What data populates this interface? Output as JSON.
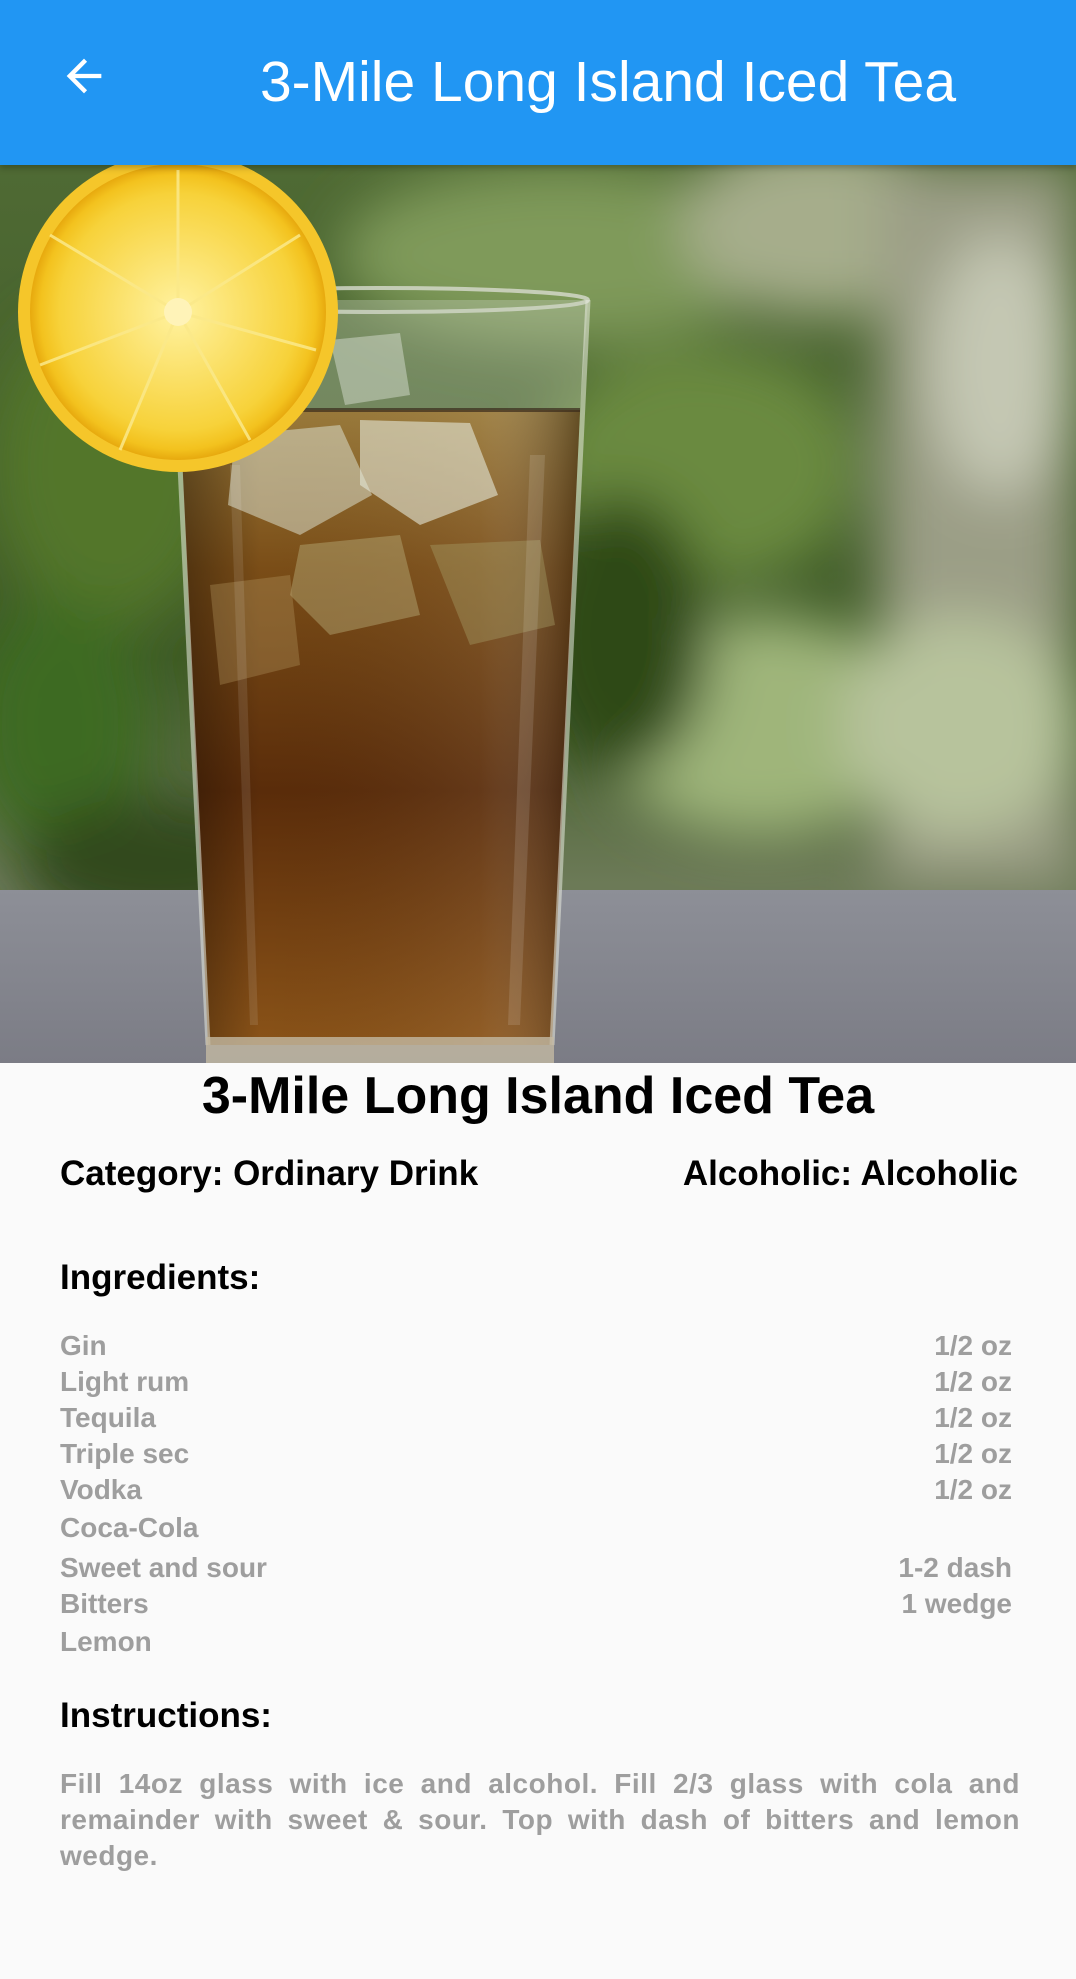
{
  "appbar": {
    "title": "3-Mile Long Island Iced Tea",
    "back_icon": "arrow-left-icon",
    "color": "#2196f3"
  },
  "drink": {
    "name": "3-Mile Long Island Iced Tea",
    "category": "Category: Ordinary Drink",
    "alcoholic": "Alcoholic: Alcoholic"
  },
  "ingredients_heading": "Ingredients:",
  "ingredients": [
    {
      "name": "Gin",
      "measure": "1/2 oz"
    },
    {
      "name": "Light rum",
      "measure": "1/2 oz"
    },
    {
      "name": "Tequila",
      "measure": "1/2 oz"
    },
    {
      "name": "Triple sec",
      "measure": "1/2 oz"
    },
    {
      "name": "Vodka",
      "measure": "1/2 oz"
    },
    {
      "name": "Coca-Cola",
      "measure": ""
    },
    {
      "name": "Sweet and sour",
      "measure": "1-2 dash"
    },
    {
      "name": "Bitters",
      "measure": "1 wedge"
    },
    {
      "name": "Lemon",
      "measure": ""
    }
  ],
  "instructions_heading": "Instructions:",
  "instructions": "Fill 14oz glass with ice and alcohol. Fill 2/3 glass with cola and remainder with sweet & sour. Top with dash of bitters and lemon wedge."
}
